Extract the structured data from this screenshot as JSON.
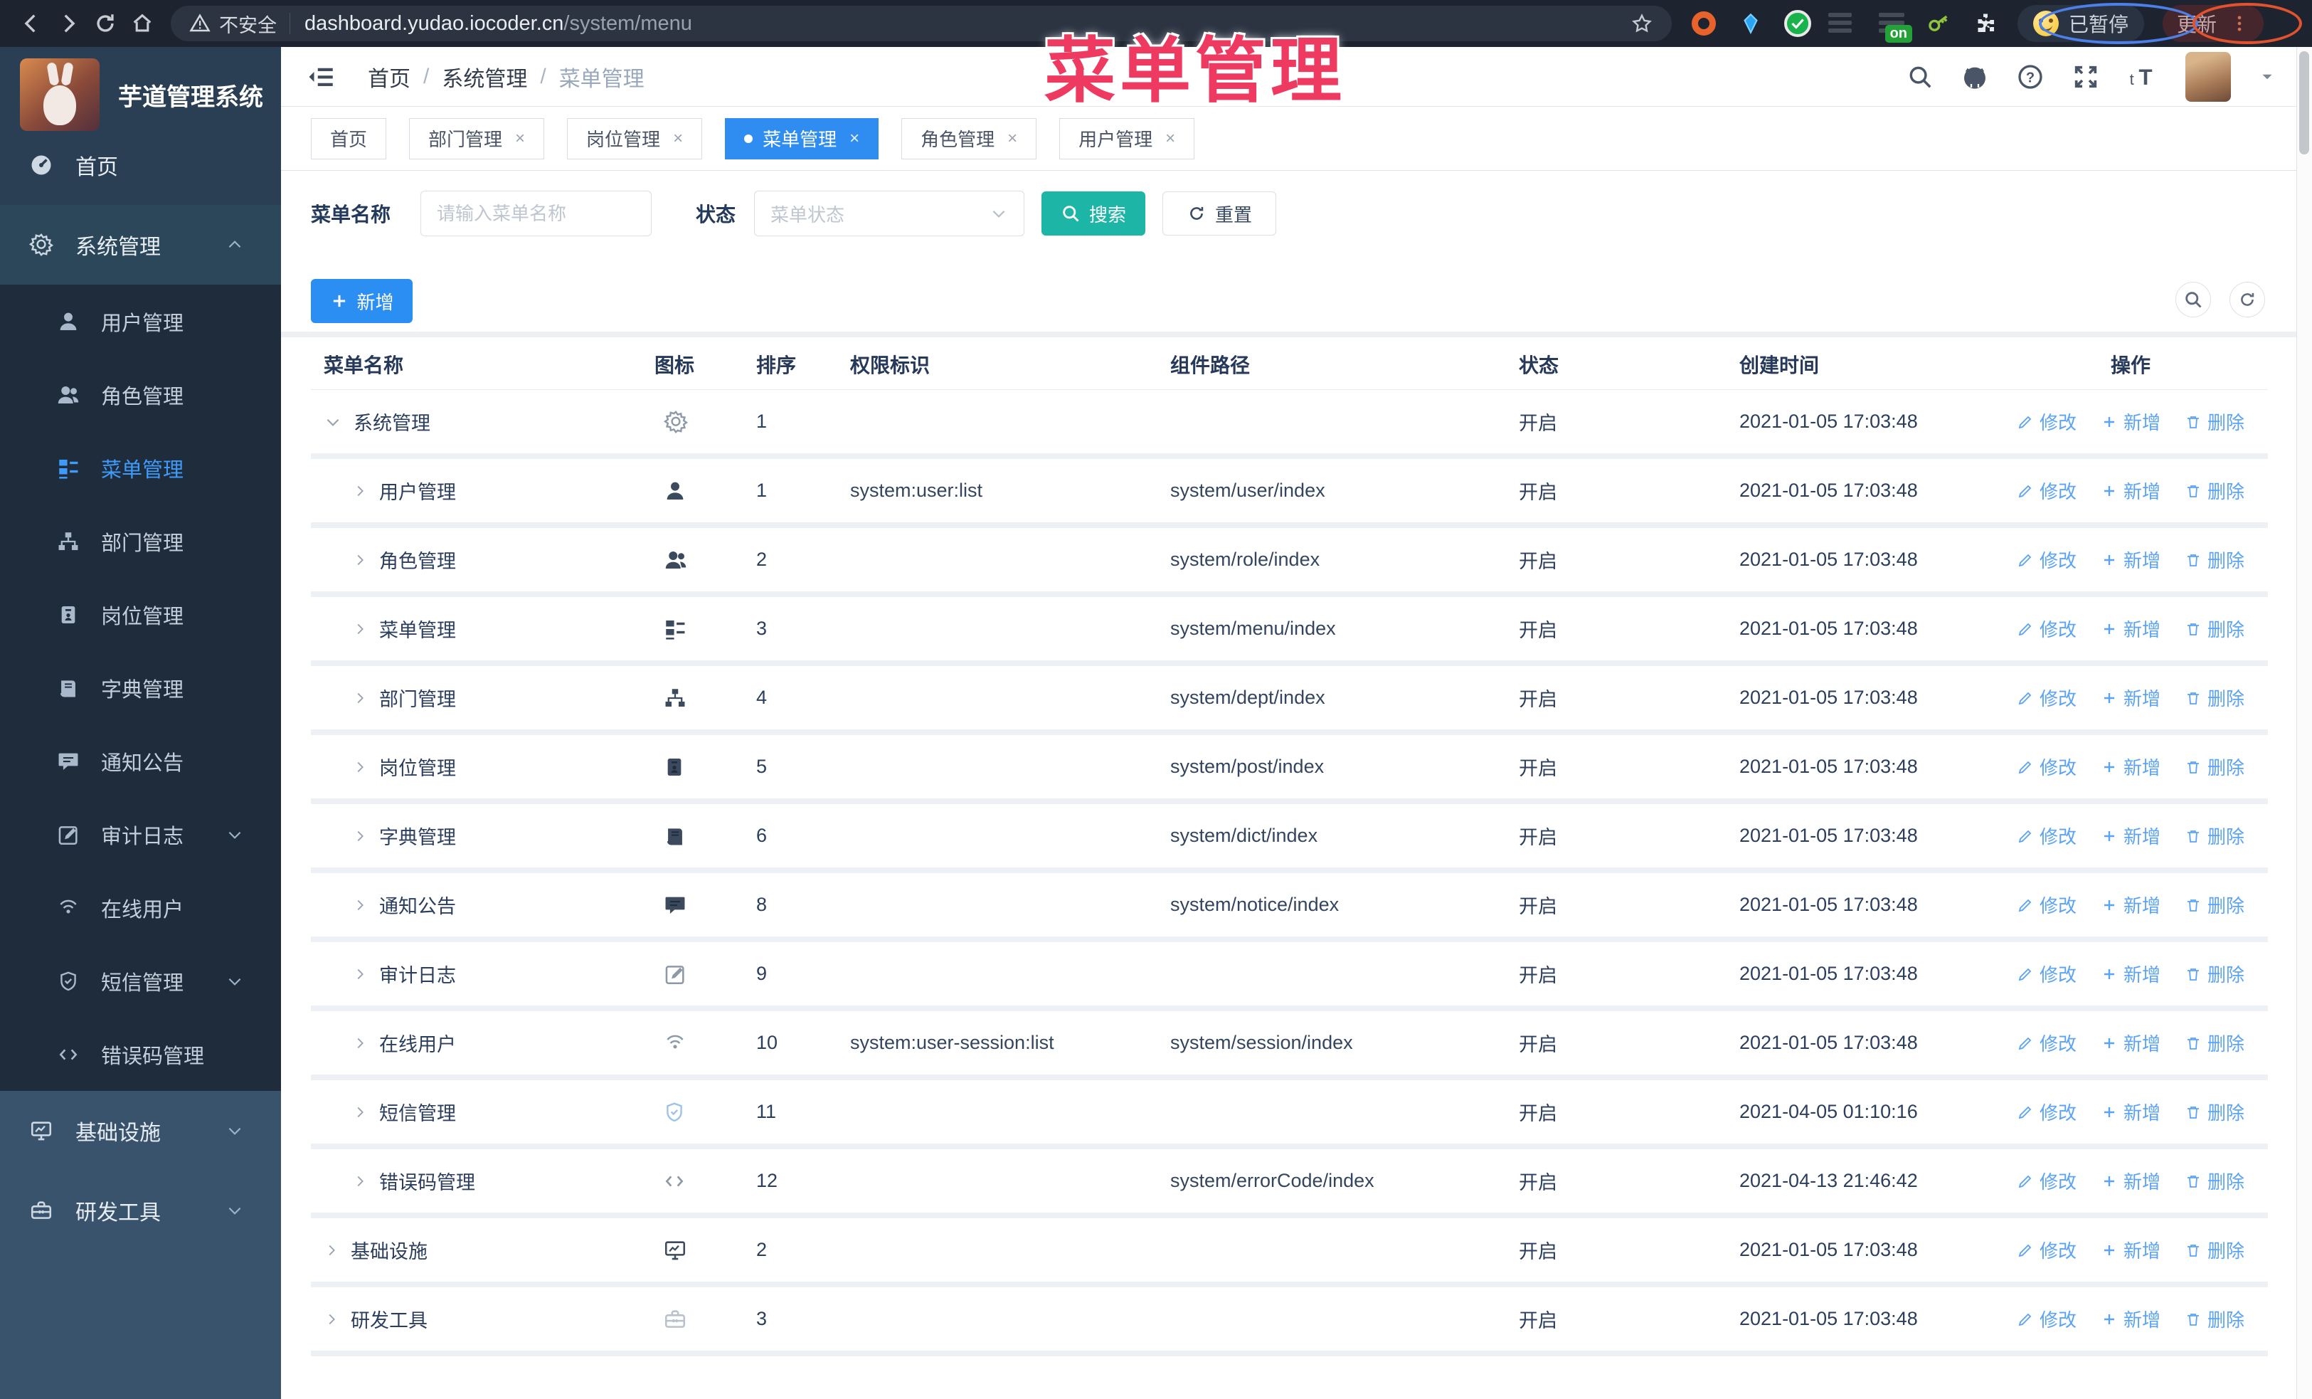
{
  "browser": {
    "security_label": "不安全",
    "url_host": "dashboard.yudao.iocoder.cn",
    "url_path": "/system/menu",
    "extension_on_badge": "on",
    "paused_label": "已暂停",
    "update_label": "更新"
  },
  "overlay": {
    "title": "菜单管理"
  },
  "sidebar": {
    "app_title": "芋道管理系统",
    "items": [
      {
        "label": "首页",
        "icon": "dashboard-icon",
        "level": 1
      },
      {
        "label": "系统管理",
        "icon": "gear-icon",
        "level": 1,
        "caret": "up",
        "open": true
      },
      {
        "label": "用户管理",
        "icon": "user-icon",
        "level": 2
      },
      {
        "label": "角色管理",
        "icon": "users-icon",
        "level": 2
      },
      {
        "label": "菜单管理",
        "icon": "menu-tree-icon",
        "level": 2,
        "active": true
      },
      {
        "label": "部门管理",
        "icon": "org-tree-icon",
        "level": 2
      },
      {
        "label": "岗位管理",
        "icon": "badge-icon",
        "level": 2
      },
      {
        "label": "字典管理",
        "icon": "book-icon",
        "level": 2
      },
      {
        "label": "通知公告",
        "icon": "message-icon",
        "level": 2
      },
      {
        "label": "审计日志",
        "icon": "edit-icon",
        "level": 2,
        "caret": "down"
      },
      {
        "label": "在线用户",
        "icon": "signal-icon",
        "level": 2
      },
      {
        "label": "短信管理",
        "icon": "shield-icon",
        "level": 2,
        "caret": "down"
      },
      {
        "label": "错误码管理",
        "icon": "code-icon",
        "level": 2
      },
      {
        "label": "基础设施",
        "icon": "monitor-icon",
        "level": 1,
        "caret": "down",
        "section": "low"
      },
      {
        "label": "研发工具",
        "icon": "toolbox-icon",
        "level": 1,
        "caret": "down",
        "section": "low"
      }
    ]
  },
  "header": {
    "breadcrumb": [
      "首页",
      "系统管理",
      "菜单管理"
    ]
  },
  "tabs": [
    {
      "label": "首页",
      "closable": false,
      "active": false
    },
    {
      "label": "部门管理",
      "closable": true,
      "active": false
    },
    {
      "label": "岗位管理",
      "closable": true,
      "active": false
    },
    {
      "label": "菜单管理",
      "closable": true,
      "active": true
    },
    {
      "label": "角色管理",
      "closable": true,
      "active": false
    },
    {
      "label": "用户管理",
      "closable": true,
      "active": false
    }
  ],
  "filters": {
    "name_label": "菜单名称",
    "name_placeholder": "请输入菜单名称",
    "status_label": "状态",
    "status_placeholder": "菜单状态",
    "search_label": "搜索",
    "reset_label": "重置"
  },
  "toolbar": {
    "add_label": "新增"
  },
  "row_actions": [
    {
      "label": "修改",
      "icon": "pencil-icon"
    },
    {
      "label": "新增",
      "icon": "plus-icon"
    },
    {
      "label": "删除",
      "icon": "trash-icon"
    }
  ],
  "table": {
    "columns": [
      "菜单名称",
      "图标",
      "排序",
      "权限标识",
      "组件路径",
      "状态",
      "创建时间",
      "操作"
    ],
    "rows": [
      {
        "name": "系统管理",
        "icon": "gear-icon",
        "tone": "gray",
        "sort": "1",
        "perm": "",
        "path": "",
        "status": "开启",
        "time": "2021-01-05 17:03:48",
        "level": 1,
        "caret": "down"
      },
      {
        "name": "用户管理",
        "icon": "user-icon",
        "tone": "dark",
        "sort": "1",
        "perm": "system:user:list",
        "path": "system/user/index",
        "status": "开启",
        "time": "2021-01-05 17:03:48",
        "level": 2,
        "caret": "right"
      },
      {
        "name": "角色管理",
        "icon": "users-icon",
        "tone": "dark",
        "sort": "2",
        "perm": "",
        "path": "system/role/index",
        "status": "开启",
        "time": "2021-01-05 17:03:48",
        "level": 2,
        "caret": "right"
      },
      {
        "name": "菜单管理",
        "icon": "menu-tree-icon",
        "tone": "dark",
        "sort": "3",
        "perm": "",
        "path": "system/menu/index",
        "status": "开启",
        "time": "2021-01-05 17:03:48",
        "level": 2,
        "caret": "right"
      },
      {
        "name": "部门管理",
        "icon": "org-tree-icon",
        "tone": "dark",
        "sort": "4",
        "perm": "",
        "path": "system/dept/index",
        "status": "开启",
        "time": "2021-01-05 17:03:48",
        "level": 2,
        "caret": "right"
      },
      {
        "name": "岗位管理",
        "icon": "badge-icon",
        "tone": "dark",
        "sort": "5",
        "perm": "",
        "path": "system/post/index",
        "status": "开启",
        "time": "2021-01-05 17:03:48",
        "level": 2,
        "caret": "right"
      },
      {
        "name": "字典管理",
        "icon": "book-icon",
        "tone": "dark",
        "sort": "6",
        "perm": "",
        "path": "system/dict/index",
        "status": "开启",
        "time": "2021-01-05 17:03:48",
        "level": 2,
        "caret": "right"
      },
      {
        "name": "通知公告",
        "icon": "message-icon",
        "tone": "dark",
        "sort": "8",
        "perm": "",
        "path": "system/notice/index",
        "status": "开启",
        "time": "2021-01-05 17:03:48",
        "level": 2,
        "caret": "right"
      },
      {
        "name": "审计日志",
        "icon": "edit-icon",
        "tone": "gray",
        "sort": "9",
        "perm": "",
        "path": "",
        "status": "开启",
        "time": "2021-01-05 17:03:48",
        "level": 2,
        "caret": "right"
      },
      {
        "name": "在线用户",
        "icon": "signal-icon",
        "tone": "gray",
        "sort": "10",
        "perm": "system:user-session:list",
        "path": "system/session/index",
        "status": "开启",
        "time": "2021-01-05 17:03:48",
        "level": 2,
        "caret": "right"
      },
      {
        "name": "短信管理",
        "icon": "shield-icon",
        "tone": "blue",
        "sort": "11",
        "perm": "",
        "path": "",
        "status": "开启",
        "time": "2021-04-05 01:10:16",
        "level": 2,
        "caret": "right"
      },
      {
        "name": "错误码管理",
        "icon": "code-icon",
        "tone": "gray",
        "sort": "12",
        "perm": "",
        "path": "system/errorCode/index",
        "status": "开启",
        "time": "2021-04-13 21:46:42",
        "level": 2,
        "caret": "right"
      },
      {
        "name": "基础设施",
        "icon": "monitor-icon",
        "tone": "dark",
        "sort": "2",
        "perm": "",
        "path": "",
        "status": "开启",
        "time": "2021-01-05 17:03:48",
        "level": 1,
        "caret": "right"
      },
      {
        "name": "研发工具",
        "icon": "toolbox-icon",
        "tone": "pale",
        "sort": "3",
        "perm": "",
        "path": "",
        "status": "开启",
        "time": "2021-01-05 17:03:48",
        "level": 1,
        "caret": "right"
      }
    ]
  },
  "colors": {
    "accent_blue": "#409EFF",
    "search_teal": "#1DB5A6",
    "annotation_red": "#EE3A60",
    "sidebar_dark": "#2B3F54"
  }
}
